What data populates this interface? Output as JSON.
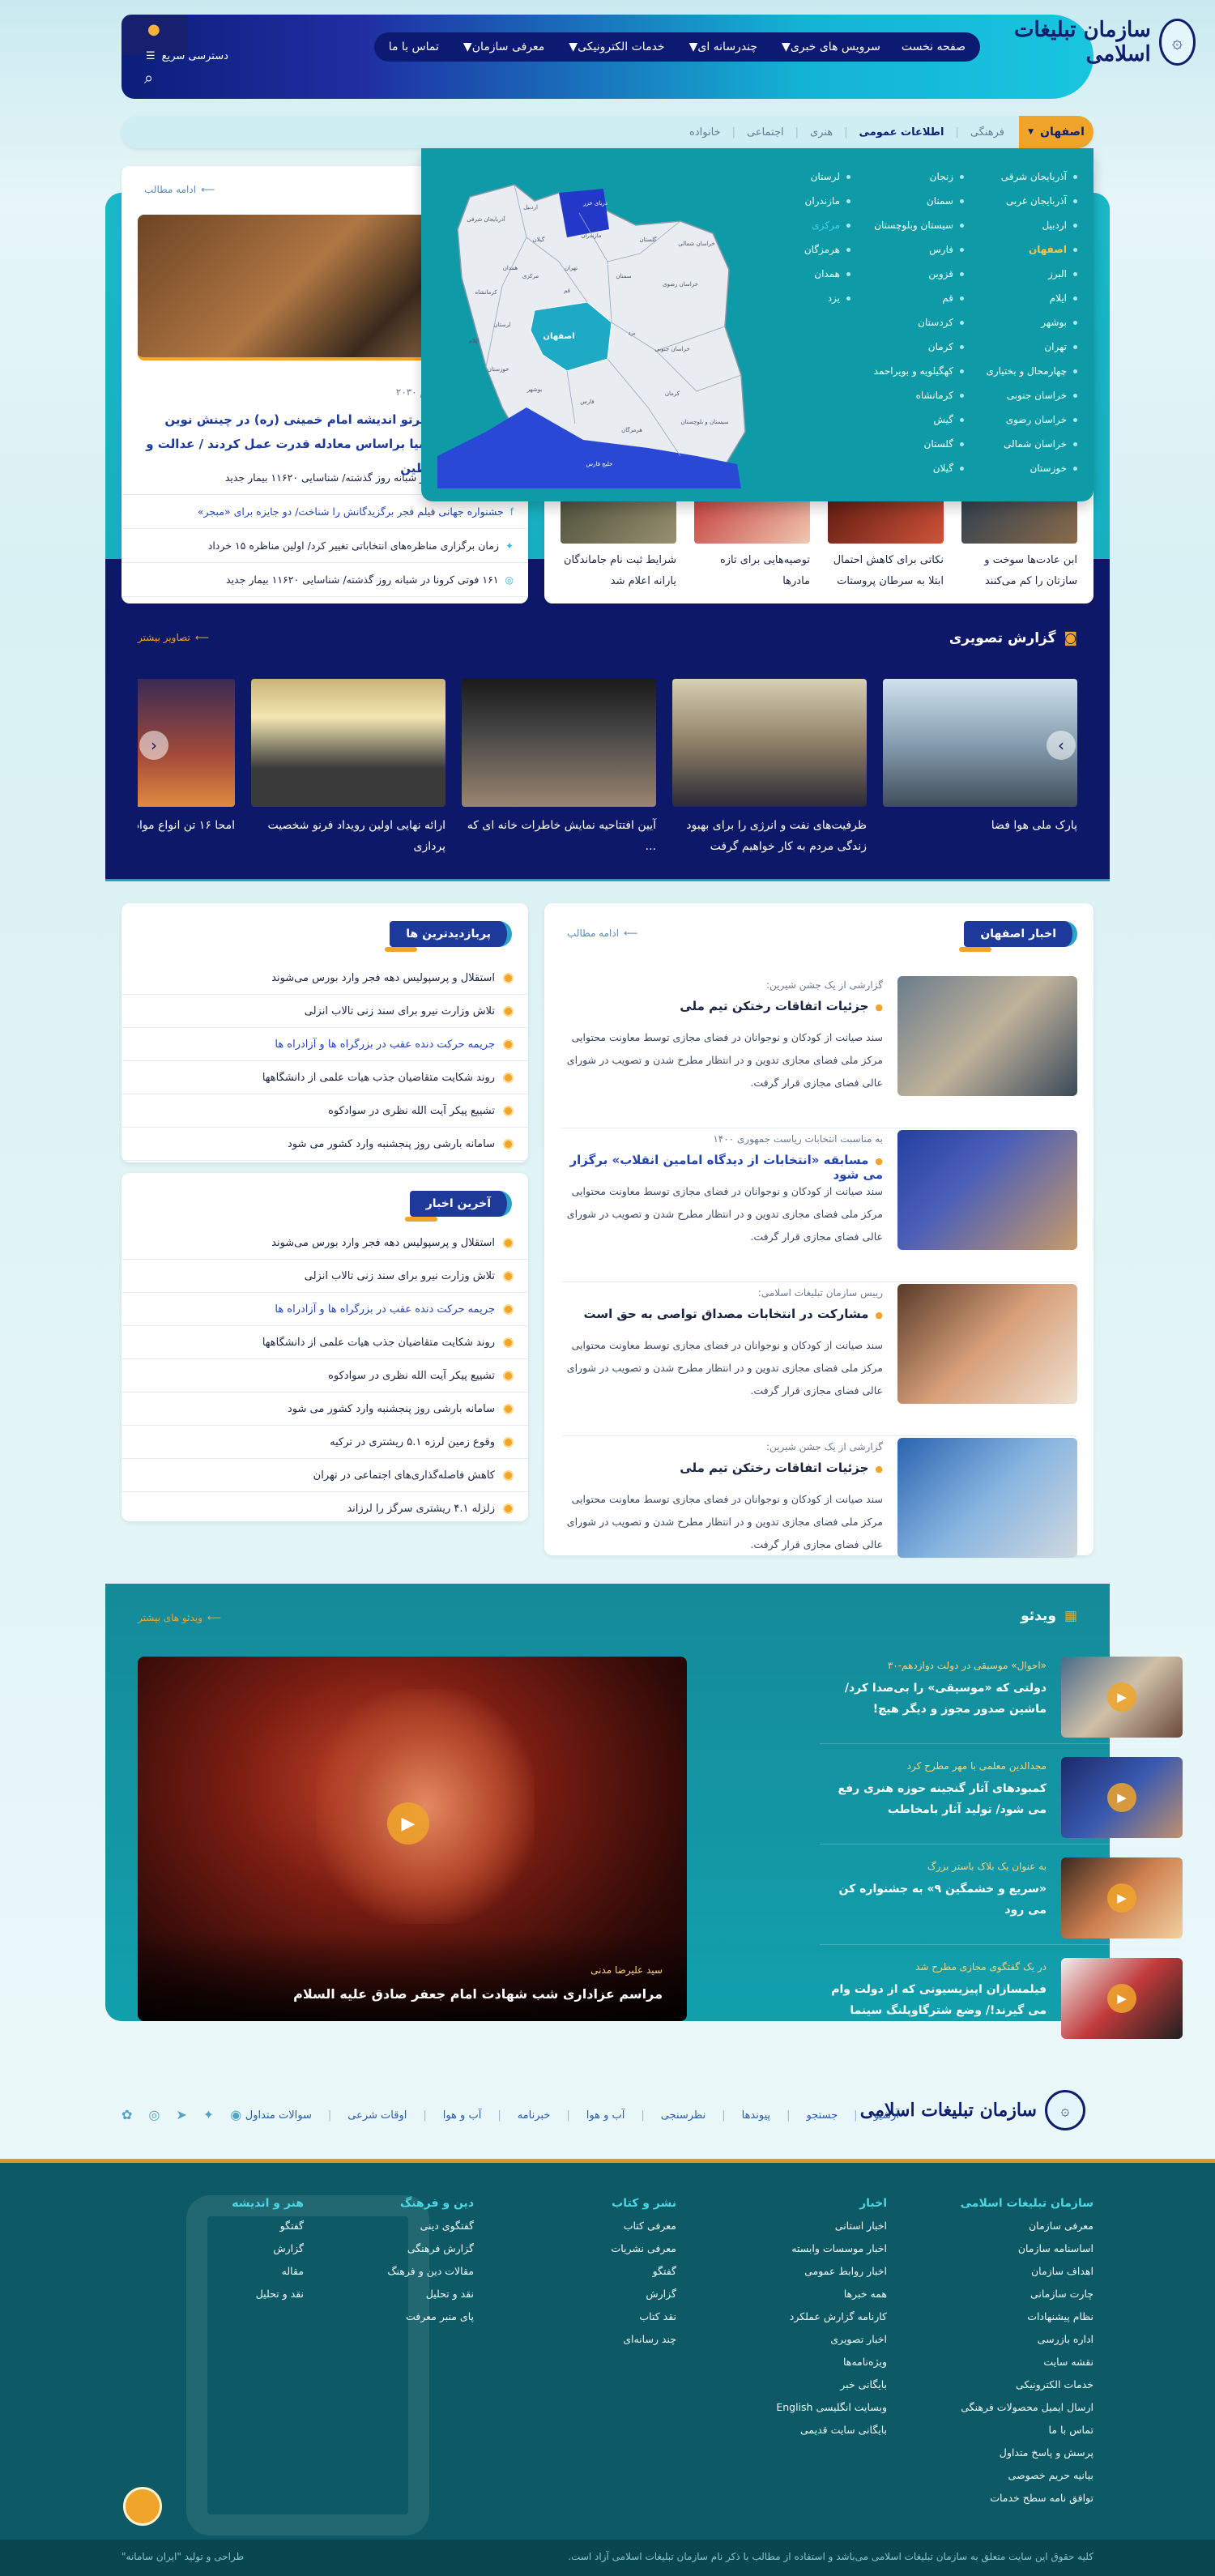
{
  "header": {
    "logo_text": "سازمان تبلیغات اسلامی",
    "nav": [
      {
        "label": "صفحه نخست",
        "has_menu": false
      },
      {
        "label": "سرویس های خبری",
        "has_menu": true
      },
      {
        "label": "چندرسانه ای",
        "has_menu": true
      },
      {
        "label": "خدمات الکترونیکی",
        "has_menu": true
      },
      {
        "label": "معرفی سازمان",
        "has_menu": true
      },
      {
        "label": "تماس با ما",
        "has_menu": false
      }
    ],
    "quick_access": "دسترسی سریع"
  },
  "subnav": {
    "province": "اصفهان",
    "items": [
      "فرهنگی",
      "اطلاعات عمومی",
      "هنری",
      "اجتماعی",
      "خانواده"
    ],
    "active": "اطلاعات عمومی"
  },
  "provinces": {
    "col1": [
      "آذربایجان شرقی",
      "آذربایجان غربی",
      "اردبیل",
      "اصفهان",
      "البرز",
      "ایلام",
      "بوشهر",
      "تهران",
      "چهارمحال و بختیاری",
      "خراسان جنوبی",
      "خراسان رضوی",
      "خراسان شمالی",
      "خوزستان"
    ],
    "col2": [
      "زنجان",
      "سمنان",
      "سیستان وبلوچستان",
      "فارس",
      "قزوین",
      "قم",
      "کردستان",
      "کرمان",
      "کهگیلویه و بویراحمد",
      "کرمانشاه",
      "گیش",
      "گلستان",
      "گیلان"
    ],
    "col3": [
      "لرستان",
      "مازندران",
      "مرکزی",
      "هرمزگان",
      "همدان",
      "یزد"
    ],
    "selected": "اصفهان",
    "highlight": "مرکزی",
    "map_labels": [
      "آذربایجان شرقی",
      "اردبیل",
      "گیلان",
      "مازندران",
      "گلستان",
      "خراسان شمالی",
      "خراسان رضوی",
      "خراسان جنوبی",
      "سمنان",
      "تهران",
      "قم",
      "مرکزی",
      "همدان",
      "کرمانشاه",
      "لرستان",
      "ایلام",
      "خوزستان",
      "اصفهان",
      "یزد",
      "کرمان",
      "سیستان و بلوچستان",
      "فارس",
      "بوشهر",
      "هرمزگان",
      "خلیج فارس",
      "دریای خزر"
    ]
  },
  "top_news": {
    "more": "ادامه مطالب",
    "pre": "مذاکره‌ی مدافعین حرم ۲۰۳۰",
    "title": "مردم ایران در پرتو اندیشه امام خمینی (ره) در چینش نوین منطقه غرب آسیا براساس معادله قدرت عمل کردند / عدالت و جهانی به فلسطین",
    "list": [
      {
        "text": "۱۶۱ فوتی کرونا در شبانه روز گذشته/ شناسایی ۱۱۶۲۰ بیمار جدید",
        "icon": "camera-icon",
        "blue": false
      },
      {
        "text": "جشنواره جهانی فیلم فجر برگزیدگانش را شناخت/ دو جایزه برای «مبجر»",
        "icon": "facebook-icon",
        "blue": true
      },
      {
        "text": "زمان برگزاری مناظره‌های انتخاباتی تغییر کرد/ اولین مناظره ۱۵ خرداد",
        "icon": "twitter-icon",
        "blue": false
      },
      {
        "text": "۱۶۱ فوتی کرونا در شبانه روز گذشته/ شناسایی ۱۱۶۲۰ بیمار جدید",
        "icon": "instagram-icon",
        "blue": false
      }
    ]
  },
  "mid_thumbs": [
    {
      "title": "ابن عادت‌ها سوخت و سازتان را کم می‌کنند"
    },
    {
      "title": "نکاتی برای کاهش احتمال ابتلا به سرطان پروستات"
    },
    {
      "title": "توصیه‌هایی برای تازه مادرها"
    },
    {
      "title": "شرایط ثبت نام جاماندگان یارانه اعلام شد"
    }
  ],
  "gallery": {
    "title": "گزارش تصویری",
    "more": "تصاویر بیشتر",
    "items": [
      {
        "title": "پارک ملی هوا فضا"
      },
      {
        "title": "ظرفیت‌های نفت و انرژی را برای بهبود زندگی مردم به کار خواهیم گرفت"
      },
      {
        "title": "آیین افتتاحیه نمایش خاطرات خانه ای که ..."
      },
      {
        "title": "ارائه نهایی اولین رویداد فرنو شخصیت پردازی"
      },
      {
        "title": "امحا ۱۶ تن انواع مواد"
      }
    ]
  },
  "province_news": {
    "title": "اخبار اصفهان",
    "more": "ادامه مطالب",
    "items": [
      {
        "pre": "گزارشی از یک جشن شیرین:",
        "title": "جزئیات اتفاقات رختکن تیم ملی",
        "blue": false,
        "desc": "سند صیانت از کودکان و نوجوانان در فضای مجازی توسط معاونت محتوایی مرکز ملی فضای مجازی تدوین و در انتظار مطرح شدن و تصویب در شورای عالی فضای مجازی قرار گرفت."
      },
      {
        "pre": "به مناسبت انتخابات ریاست جمهوری ۱۴۰۰",
        "title": "مسابقه «انتخابات از دیدگاه امامین انقلاب» برگزار می شود",
        "blue": true,
        "desc": "سند صیانت از کودکان و نوجوانان در فضای مجازی توسط معاونت محتوایی مرکز ملی فضای مجازی تدوین و در انتظار مطرح شدن و تصویب در شورای عالی فضای مجازی قرار گرفت."
      },
      {
        "pre": "رییس سازمان تبلیغات اسلامی:",
        "title": "مشارکت در انتخابات مصداق تواصی به حق است",
        "blue": false,
        "desc": "سند صیانت از کودکان و نوجوانان در فضای مجازی توسط معاونت محتوایی مرکز ملی فضای مجازی تدوین و در انتظار مطرح شدن و تصویب در شورای عالی فضای مجازی قرار گرفت."
      },
      {
        "pre": "گزارشی از یک جشن شیرین:",
        "title": "جزئیات اتفاقات رختکن تیم ملی",
        "blue": false,
        "desc": "سند صیانت از کودکان و نوجوانان در فضای مجازی توسط معاونت محتوایی مرکز ملی فضای مجازی تدوین و در انتظار مطرح شدن و تصویب در شورای عالی فضای مجازی قرار گرفت."
      }
    ]
  },
  "most_viewed": {
    "title": "پربازدیدترین ها",
    "items": [
      {
        "text": "استقلال و پرسپولیس دهه فجر وارد بورس می‌شوند",
        "blue": false
      },
      {
        "text": "تلاش وزارت نیرو برای سند زنی تالاب انزلی",
        "blue": false
      },
      {
        "text": "جریمه حرکت دنده عقب در بزرگراه ها و آزادراه ها",
        "blue": true
      },
      {
        "text": "روند شکایت متقاضیان جذب هیات علمی از دانشگاهها",
        "blue": false
      },
      {
        "text": "تشییع پیکر آیت الله نظری در سوادکوه",
        "blue": false
      },
      {
        "text": "سامانه بارشی روز پنجشنبه وارد کشور می شود",
        "blue": false
      }
    ]
  },
  "latest": {
    "title": "آخرین اخبار",
    "items": [
      {
        "text": "استقلال و پرسپولیس دهه فجر وارد بورس می‌شوند",
        "blue": false
      },
      {
        "text": "تلاش وزارت نیرو برای سند زنی تالاب انزلی",
        "blue": false
      },
      {
        "text": "جریمه حرکت دنده عقب در بزرگراه ها و آزادراه ها",
        "blue": true
      },
      {
        "text": "روند شکایت متقاضیان جذب هیات علمی از دانشگاهها",
        "blue": false
      },
      {
        "text": "تشییع پیکر آیت الله نظری در سوادکوه",
        "blue": false
      },
      {
        "text": "سامانه بارشی روز پنجشنبه وارد کشور می شود",
        "blue": false
      },
      {
        "text": "وقوع زمین لرزه ۵.۱ ریشتری در ترکیه",
        "blue": false
      },
      {
        "text": "کاهش فاصله‌گذاری‌های اجتماعی در تهران",
        "blue": false
      },
      {
        "text": "زلزله ۴.۱ ریشتری سرگز را لرزاند",
        "blue": false
      }
    ]
  },
  "video": {
    "title": "ویدئو",
    "more": "ویدئو های بیشتر",
    "featured": {
      "pre": "سید علیرضا مدنی",
      "title": "مراسم عزاداری شب شهادت امام جعفر صادق علیه السلام"
    },
    "items": [
      {
        "pre": "«احوال» موسیقی در دولت دوازدهم-۳۰",
        "title": "دولتی که «موسیقی» را بی‌صدا کرد/ ماشین صدور مجوز و دیگر هیچ!"
      },
      {
        "pre": "مجدالدین معلمی با مهر مطرح کرد",
        "title": "کمبودهای آثار گنجینه حوزه هنری رفع می شود/ تولید آثار بامخاطب"
      },
      {
        "pre": "به عنوان یک بلاک باستر بزرگ",
        "title": "«سریع و خشمگین ۹» به جشنواره کن می رود"
      },
      {
        "pre": "در یک گفتگوی مجازی مطرح شد",
        "title": "فیلمسازان اپیزیسیونی که از دولت وام می گیرند!/ وضع شترگاوپلنگ سینما"
      }
    ]
  },
  "footer_links": [
    "آرشیو",
    "جستجو",
    "پیوندها",
    "نظرسنجی",
    "آب و هوا",
    "خبرنامه",
    "آب و هوا",
    "اوقات شرعی",
    "سوالات متداول"
  ],
  "footer_cols": [
    {
      "title": "سازمان تبلیغات اسلامی",
      "items": [
        "معرفی سازمان",
        "اساسنامه سازمان",
        "اهداف سازمان",
        "چارت سازمانی",
        "نظام پیشنهادات",
        "اداره بازرسی",
        "نقشه سایت",
        "خدمات الکترونیکی",
        "ارسال ایمیل محصولات فرهنگی",
        "تماس با ما",
        "پرسش و پاسخ متداول",
        "بیانیه حریم خصوصی",
        "توافق نامه سطح خدمات"
      ]
    },
    {
      "title": "اخبار",
      "items": [
        "اخبار استانی",
        "اخبار موسسات وابسته",
        "اخبار روابط عمومی",
        "همه خبرها",
        "کارنامه گزارش عملکرد",
        "اخبار تصویری",
        "ویژه‌نامه‌ها",
        "بایگانی خبر",
        "وبسایت انگلیسی English",
        "بایگانی سایت قدیمی"
      ]
    },
    {
      "title": "نشر و کتاب",
      "items": [
        "معرفی کتاب",
        "معرفی نشریات",
        "گفتگو",
        "گزارش",
        "نقد کتاب",
        "چند رسانه‌ای"
      ]
    },
    {
      "title": "دین و فرهنگ",
      "items": [
        "گفتگوی دینی",
        "گزارش فرهنگی",
        "مقالات دین و فرهنگ",
        "نقد و تحلیل",
        "پای منبر معرفت"
      ]
    },
    {
      "title": "هنر و اندیشه",
      "items": [
        "گفتگو",
        "گزارش",
        "مقاله",
        "نقد و تحلیل"
      ]
    }
  ],
  "copyright": "کلیه حقوق این سایت متعلق به سازمان تبلیغات اسلامی می‌باشد و استفاده از مطالب با ذکر نام سازمان تبلیغات اسلامی آزاد است.",
  "designer": "طراحی و تولید \"ایران سامانه\""
}
